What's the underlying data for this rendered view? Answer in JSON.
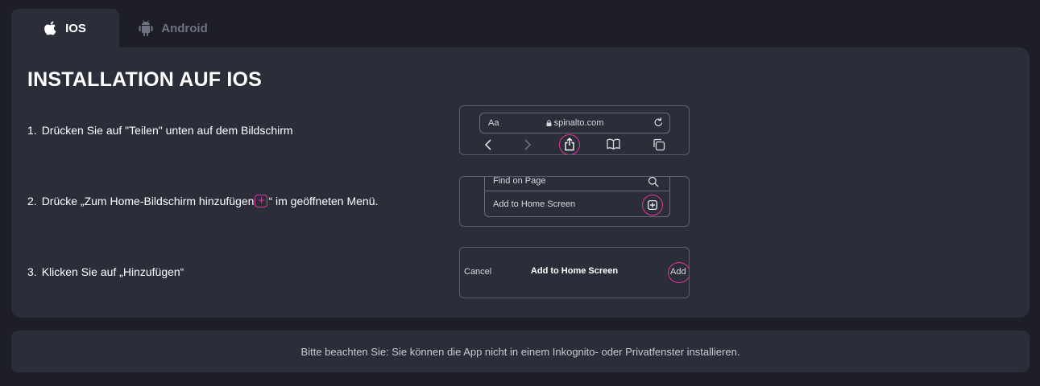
{
  "tabs": [
    {
      "label": "IOS",
      "icon": "apple-icon",
      "active": true
    },
    {
      "label": "Android",
      "icon": "android-icon",
      "active": false
    }
  ],
  "title": "INSTALLATION AUF IOS",
  "steps": [
    {
      "number": "1.",
      "text": "Drücken Sie auf \"Teilen\" unten auf dem Bildschirm"
    },
    {
      "number": "2.",
      "text_before": "Drücke „Zum Home-Bildschirm hinzufügen",
      "text_after": "“ im geöffneten Menü."
    },
    {
      "number": "3.",
      "text": "Klicken Sie auf „Hinzufügen“"
    }
  ],
  "browser_preview": {
    "aa_label": "Aa",
    "host": "spinalto.com"
  },
  "menu_preview": {
    "item1": "Find on Page",
    "item2": "Add to Home Screen"
  },
  "dialog_preview": {
    "cancel": "Cancel",
    "title": "Add to Home Screen",
    "add": "Add"
  },
  "note": "Bitte beachten Sie: Sie können die App nicht in einem Inkognito- oder Privatfenster installieren.",
  "colors": {
    "background": "#1d1e26",
    "panel": "#2b2e39",
    "accent": "#e0379b",
    "muted": "#6f7280"
  }
}
